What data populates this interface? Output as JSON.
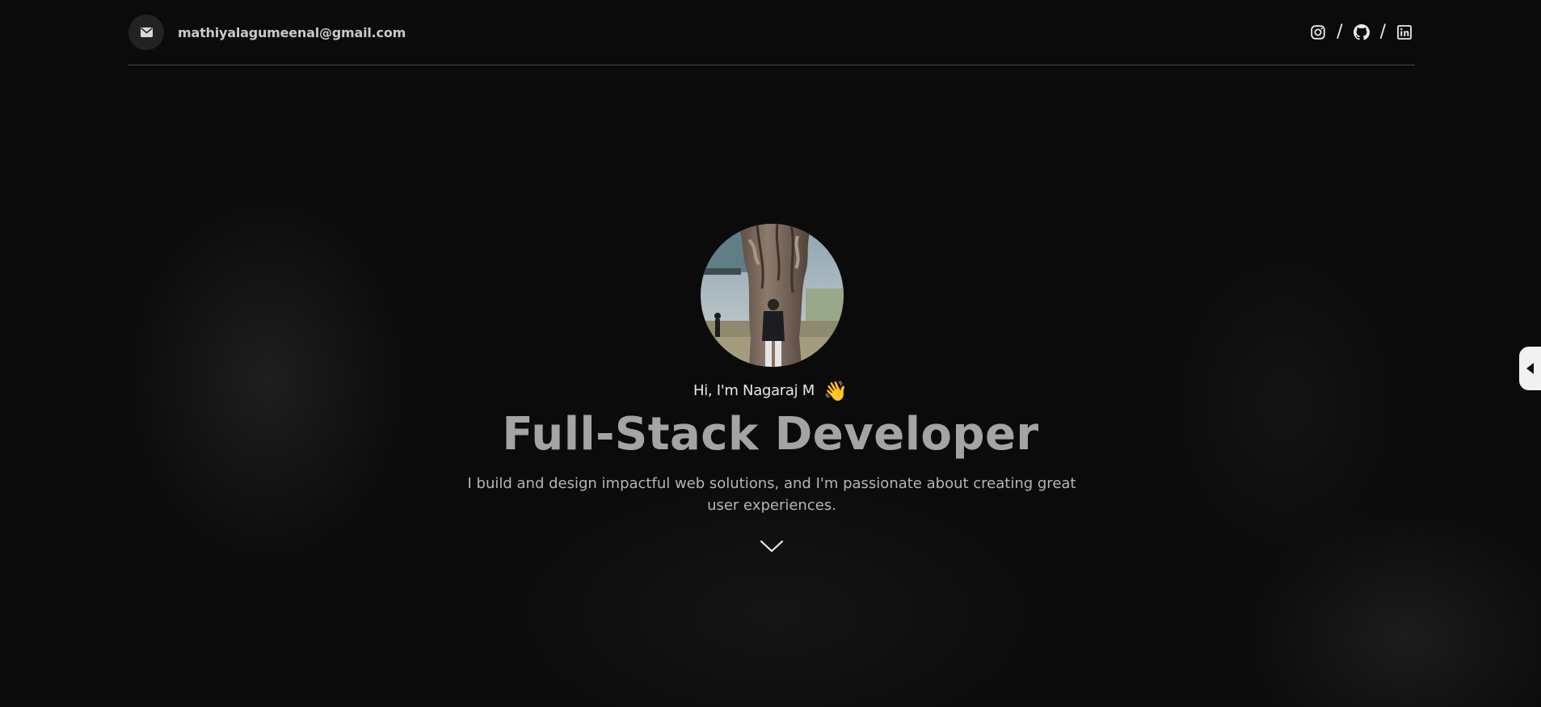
{
  "header": {
    "email": "mathiyalagumeenal@gmail.com",
    "separator": "/",
    "socials": [
      {
        "name": "instagram-icon"
      },
      {
        "name": "github-icon"
      },
      {
        "name": "linkedin-icon"
      }
    ]
  },
  "hero": {
    "greeting": "Hi, I'm Nagaraj M",
    "wave": "👋",
    "title": "Full-Stack Developer",
    "description": "I build and design impactful web solutions, and I'm passionate about creating great user experiences."
  },
  "colors": {
    "background": "#0b0b0b",
    "divider": "#4a4a4a",
    "title": "#a4a4a4",
    "side_tab": "#f1f1f1"
  },
  "icons": {
    "mail": "envelope-icon",
    "scroll": "chevron-down-icon",
    "side_tab": "caret-left-icon"
  }
}
